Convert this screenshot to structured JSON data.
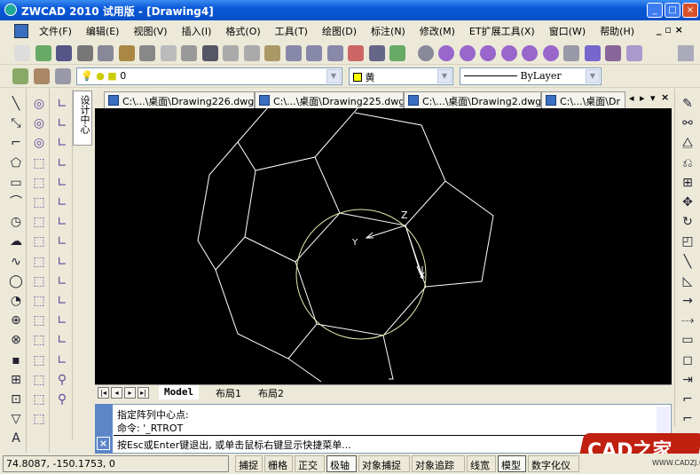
{
  "window": {
    "title": "ZWCAD 2010 试用版 - [Drawing4]",
    "minimize": "_",
    "maximize": "□",
    "close": "×"
  },
  "menu": [
    "文件(F)",
    "编辑(E)",
    "视图(V)",
    "插入(I)",
    "格式(O)",
    "工具(T)",
    "绘图(D)",
    "标注(N)",
    "修改(M)",
    "ET扩展工具(X)",
    "窗口(W)",
    "帮助(H)"
  ],
  "layer_combo": {
    "value": "0"
  },
  "color_combo": {
    "value": "黄",
    "swatch": "#ffff00"
  },
  "linetype_combo": {
    "value": "ByLayer"
  },
  "side_tab": "设计中心",
  "doc_tabs": [
    "C:\\...\\桌面\\Drawing226.dwg",
    "C:\\...\\桌面\\Drawing225.dwg",
    "C:\\...\\桌面\\Drawing2.dwg",
    "C:\\...\\桌面\\Dr"
  ],
  "tab_controls": [
    "◂",
    "▸",
    "▾",
    "×"
  ],
  "ucs": {
    "x": "X",
    "y": "Y",
    "z": "Z"
  },
  "layout_tabs": [
    "Model",
    "布局1",
    "布局2"
  ],
  "command": {
    "lines": [
      "指定阵列中心点:",
      "命令: '_RTROT"
    ],
    "prompt": "按Esc或Enter键退出, 或单击鼠标右键显示快捷菜单..."
  },
  "status": {
    "coords": "74.8087, -150.1753, 0",
    "buttons": [
      {
        "label": "捕捉",
        "on": false
      },
      {
        "label": "栅格",
        "on": false
      },
      {
        "label": "正交",
        "on": false
      },
      {
        "label": "极轴",
        "on": true
      },
      {
        "label": "对象捕捉",
        "on": false
      },
      {
        "label": "对象追踪",
        "on": false
      },
      {
        "label": "线宽",
        "on": false
      },
      {
        "label": "模型",
        "on": true
      },
      {
        "label": "数字化仪",
        "on": false
      }
    ]
  },
  "watermark": {
    "text": "CAD之家",
    "url": "WWW.CADZJ.COM"
  },
  "colors": {
    "drawing_lines": "#ffffff",
    "circle": "#e8e8b0",
    "canvas": "#000000",
    "titlebar": "#0a58d8"
  }
}
